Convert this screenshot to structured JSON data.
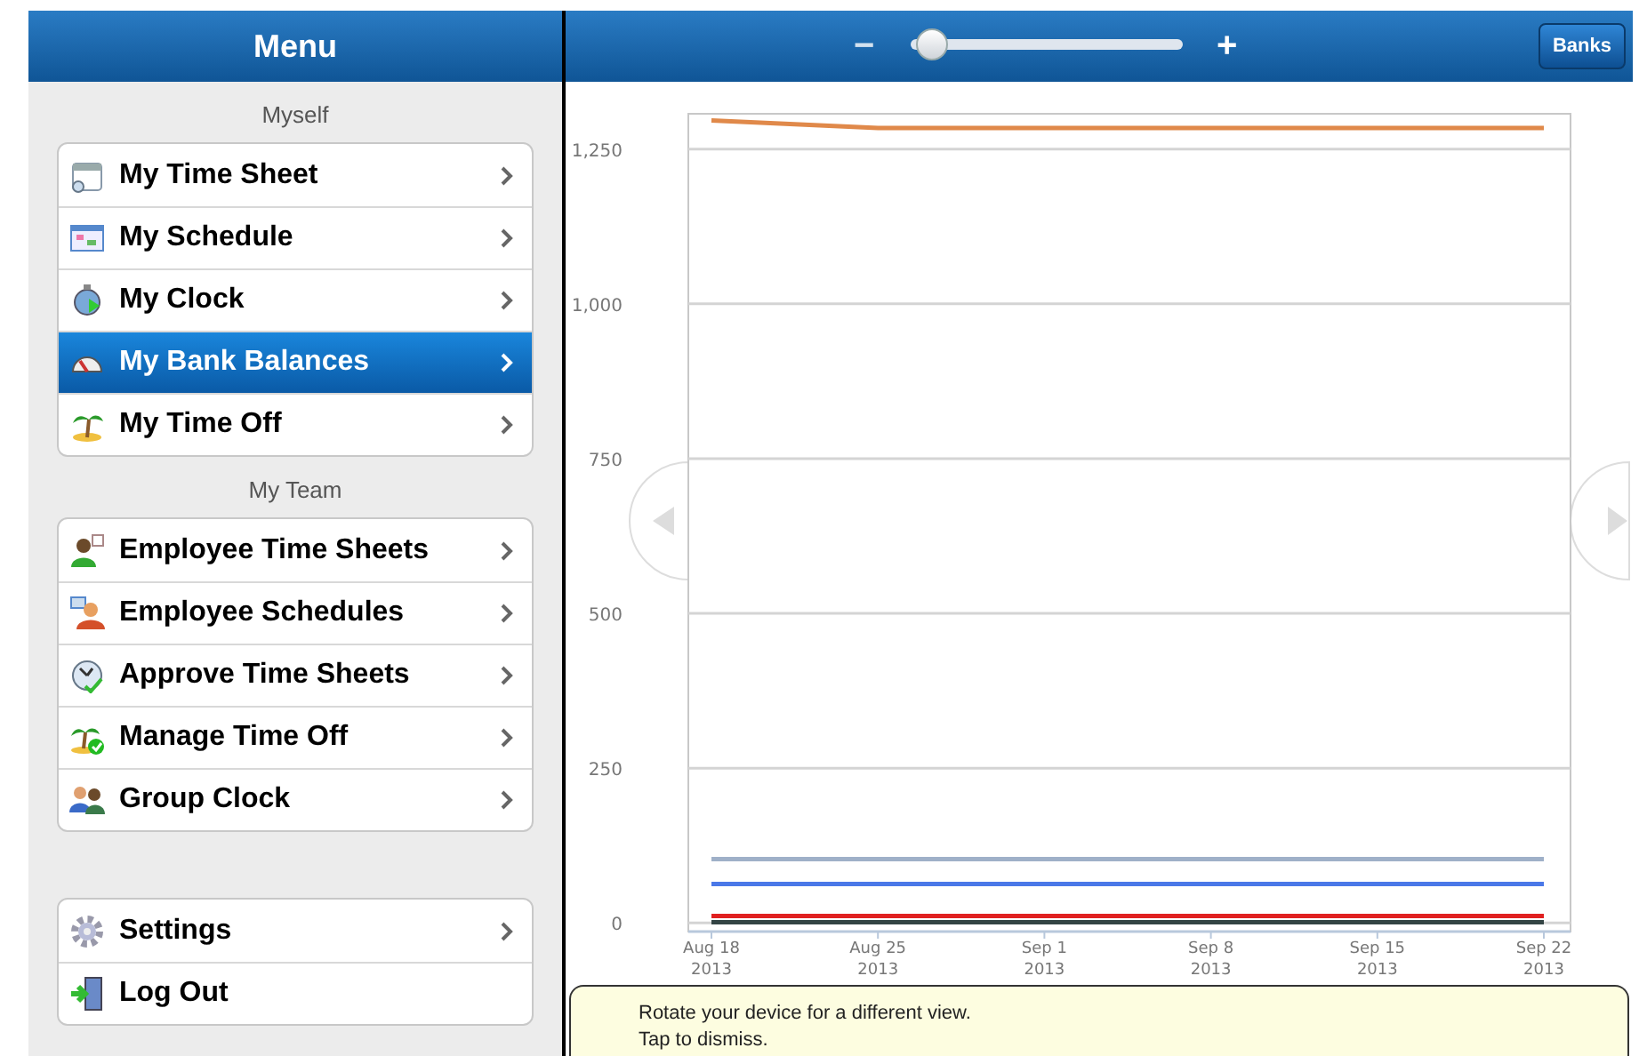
{
  "sidebar": {
    "title": "Menu",
    "sections": [
      {
        "header": "Myself",
        "items": [
          {
            "label": "My Time Sheet",
            "selected": false
          },
          {
            "label": "My Schedule",
            "selected": false
          },
          {
            "label": "My Clock",
            "selected": false
          },
          {
            "label": "My Bank Balances",
            "selected": true
          },
          {
            "label": "My Time Off",
            "selected": false
          }
        ]
      },
      {
        "header": "My Team",
        "items": [
          {
            "label": "Employee Time Sheets",
            "selected": false
          },
          {
            "label": "Employee Schedules",
            "selected": false
          },
          {
            "label": "Approve Time Sheets",
            "selected": false
          },
          {
            "label": "Manage Time Off",
            "selected": false
          },
          {
            "label": "Group Clock",
            "selected": false
          }
        ]
      },
      {
        "items": [
          {
            "label": "Settings",
            "selected": false,
            "chevron": true
          },
          {
            "label": "Log Out",
            "selected": false,
            "chevron": false
          }
        ]
      }
    ]
  },
  "toolbar": {
    "zoom_minus": "−",
    "zoom_plus": "+",
    "zoom": {
      "level": 0.02
    },
    "banks_button": "Banks"
  },
  "chart_data": {
    "type": "line",
    "categories": [
      "Aug 18\n2013",
      "Aug 25\n2013",
      "Sep 1\n2013",
      "Sep 8\n2013",
      "Sep 15\n2013",
      "Sep 22\n2013"
    ],
    "ylim": [
      -14,
      1307
    ],
    "grid": true,
    "yticks": [
      {
        "value": 0,
        "label": "0"
      },
      {
        "value": 250,
        "label": "250"
      },
      {
        "value": 500,
        "label": "500"
      },
      {
        "value": 750,
        "label": "750"
      },
      {
        "value": 1000,
        "label": "1,000"
      },
      {
        "value": 1250,
        "label": "1,250"
      }
    ],
    "series": [
      {
        "color": "#e0894a",
        "values": [
          1296,
          1284,
          1284,
          1284,
          1284,
          1284
        ]
      },
      {
        "color": "#9fb0c8",
        "values": [
          103,
          103,
          103,
          103,
          103,
          103
        ]
      },
      {
        "color": "#4a78e8",
        "values": [
          63,
          63,
          63,
          63,
          63,
          63
        ]
      },
      {
        "color": "#e02020",
        "values": [
          11,
          11,
          11,
          11,
          11,
          11
        ]
      },
      {
        "color": "#334444",
        "values": [
          1,
          1,
          1,
          1,
          1,
          1
        ]
      }
    ]
  },
  "toast": {
    "lines": [
      "Rotate your device for a different view.",
      "Tap to dismiss."
    ]
  }
}
